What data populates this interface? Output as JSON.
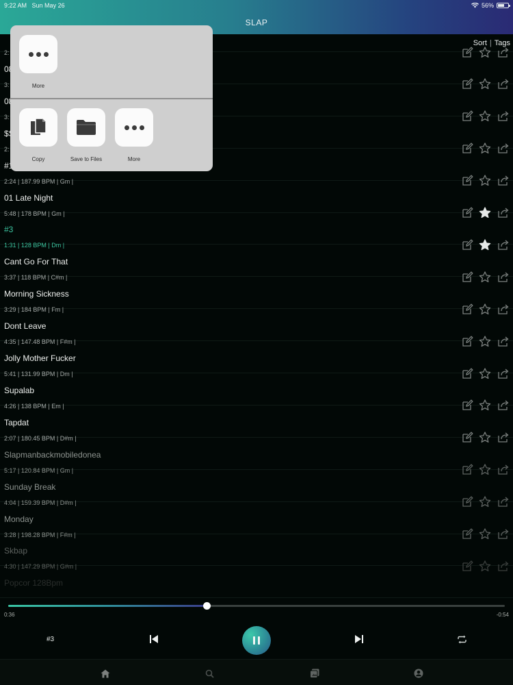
{
  "status": {
    "time": "9:22 AM",
    "date": "Sun May 26",
    "battery": "56%",
    "battery_level": 0.56
  },
  "header": {
    "title": "SLAP"
  },
  "toolbar": {
    "sort": "Sort",
    "separator": "|",
    "tags": "Tags"
  },
  "share_sheet": {
    "top_items": [
      {
        "label": "More",
        "icon": "more-icon"
      }
    ],
    "bottom_items": [
      {
        "label": "Copy",
        "icon": "copy-icon"
      },
      {
        "label": "Save to Files",
        "icon": "folder-icon"
      },
      {
        "label": "More",
        "icon": "more-icon"
      }
    ]
  },
  "tracks": [
    {
      "title": "",
      "meta": "2:",
      "starred": false,
      "state": "normal"
    },
    {
      "title": "08",
      "meta": "3:",
      "starred": false,
      "state": "normal"
    },
    {
      "title": "08",
      "meta": "3:",
      "starred": false,
      "state": "normal"
    },
    {
      "title": "$S",
      "meta": "2:",
      "starred": false,
      "state": "normal"
    },
    {
      "title": "#1",
      "meta": "2:24 | 187.99 BPM | Gm |",
      "starred": false,
      "state": "normal"
    },
    {
      "title": "01 Late Night",
      "meta": "5:48 | 178 BPM | Gm |",
      "starred": true,
      "state": "normal"
    },
    {
      "title": "#3",
      "meta": "1:31 | 128 BPM | Dm |",
      "starred": true,
      "state": "active"
    },
    {
      "title": "Cant Go For That",
      "meta": "3:37 | 118 BPM | C#m |",
      "starred": false,
      "state": "normal"
    },
    {
      "title": "Morning Sickness",
      "meta": "3:29 | 184 BPM | Fm |",
      "starred": false,
      "state": "normal"
    },
    {
      "title": "Dont Leave",
      "meta": "4:35 | 147.48 BPM | F#m |",
      "starred": false,
      "state": "normal"
    },
    {
      "title": "Jolly Mother Fucker",
      "meta": "5:41 | 131.99 BPM | Dm |",
      "starred": false,
      "state": "normal"
    },
    {
      "title": "Supalab",
      "meta": "4:26 | 138 BPM | Em |",
      "starred": false,
      "state": "normal"
    },
    {
      "title": "Tapdat",
      "meta": "2:07 | 180.45 BPM | D#m |",
      "starred": false,
      "state": "normal"
    },
    {
      "title": "Slapmanbackmobiledonea",
      "meta": "5:17 | 120.84 BPM | Gm |",
      "starred": false,
      "state": "dim"
    },
    {
      "title": "Sunday Break",
      "meta": "4:04 | 159.39 BPM | D#m |",
      "starred": false,
      "state": "dim"
    },
    {
      "title": "Monday",
      "meta": "3:28 | 198.28 BPM | F#m |",
      "starred": false,
      "state": "dim"
    },
    {
      "title": "Skbap",
      "meta": "4:30 | 147.29 BPM | G#m |",
      "starred": false,
      "state": "dimmer"
    },
    {
      "title": "Popcor 128Bpm",
      "meta": "",
      "starred": false,
      "state": "fade"
    }
  ],
  "player": {
    "elapsed": "0:36",
    "remaining": "-0:54",
    "progress": 0.4,
    "now_playing": "#3",
    "colors": {
      "accent": "#3cc5a0",
      "accent_dark": "#2a5a8a"
    }
  },
  "tabs": [
    {
      "name": "tab-home",
      "icon": "home-icon"
    },
    {
      "name": "tab-search",
      "icon": "search-icon"
    },
    {
      "name": "tab-library",
      "icon": "library-icon"
    },
    {
      "name": "tab-profile",
      "icon": "profile-icon"
    }
  ]
}
